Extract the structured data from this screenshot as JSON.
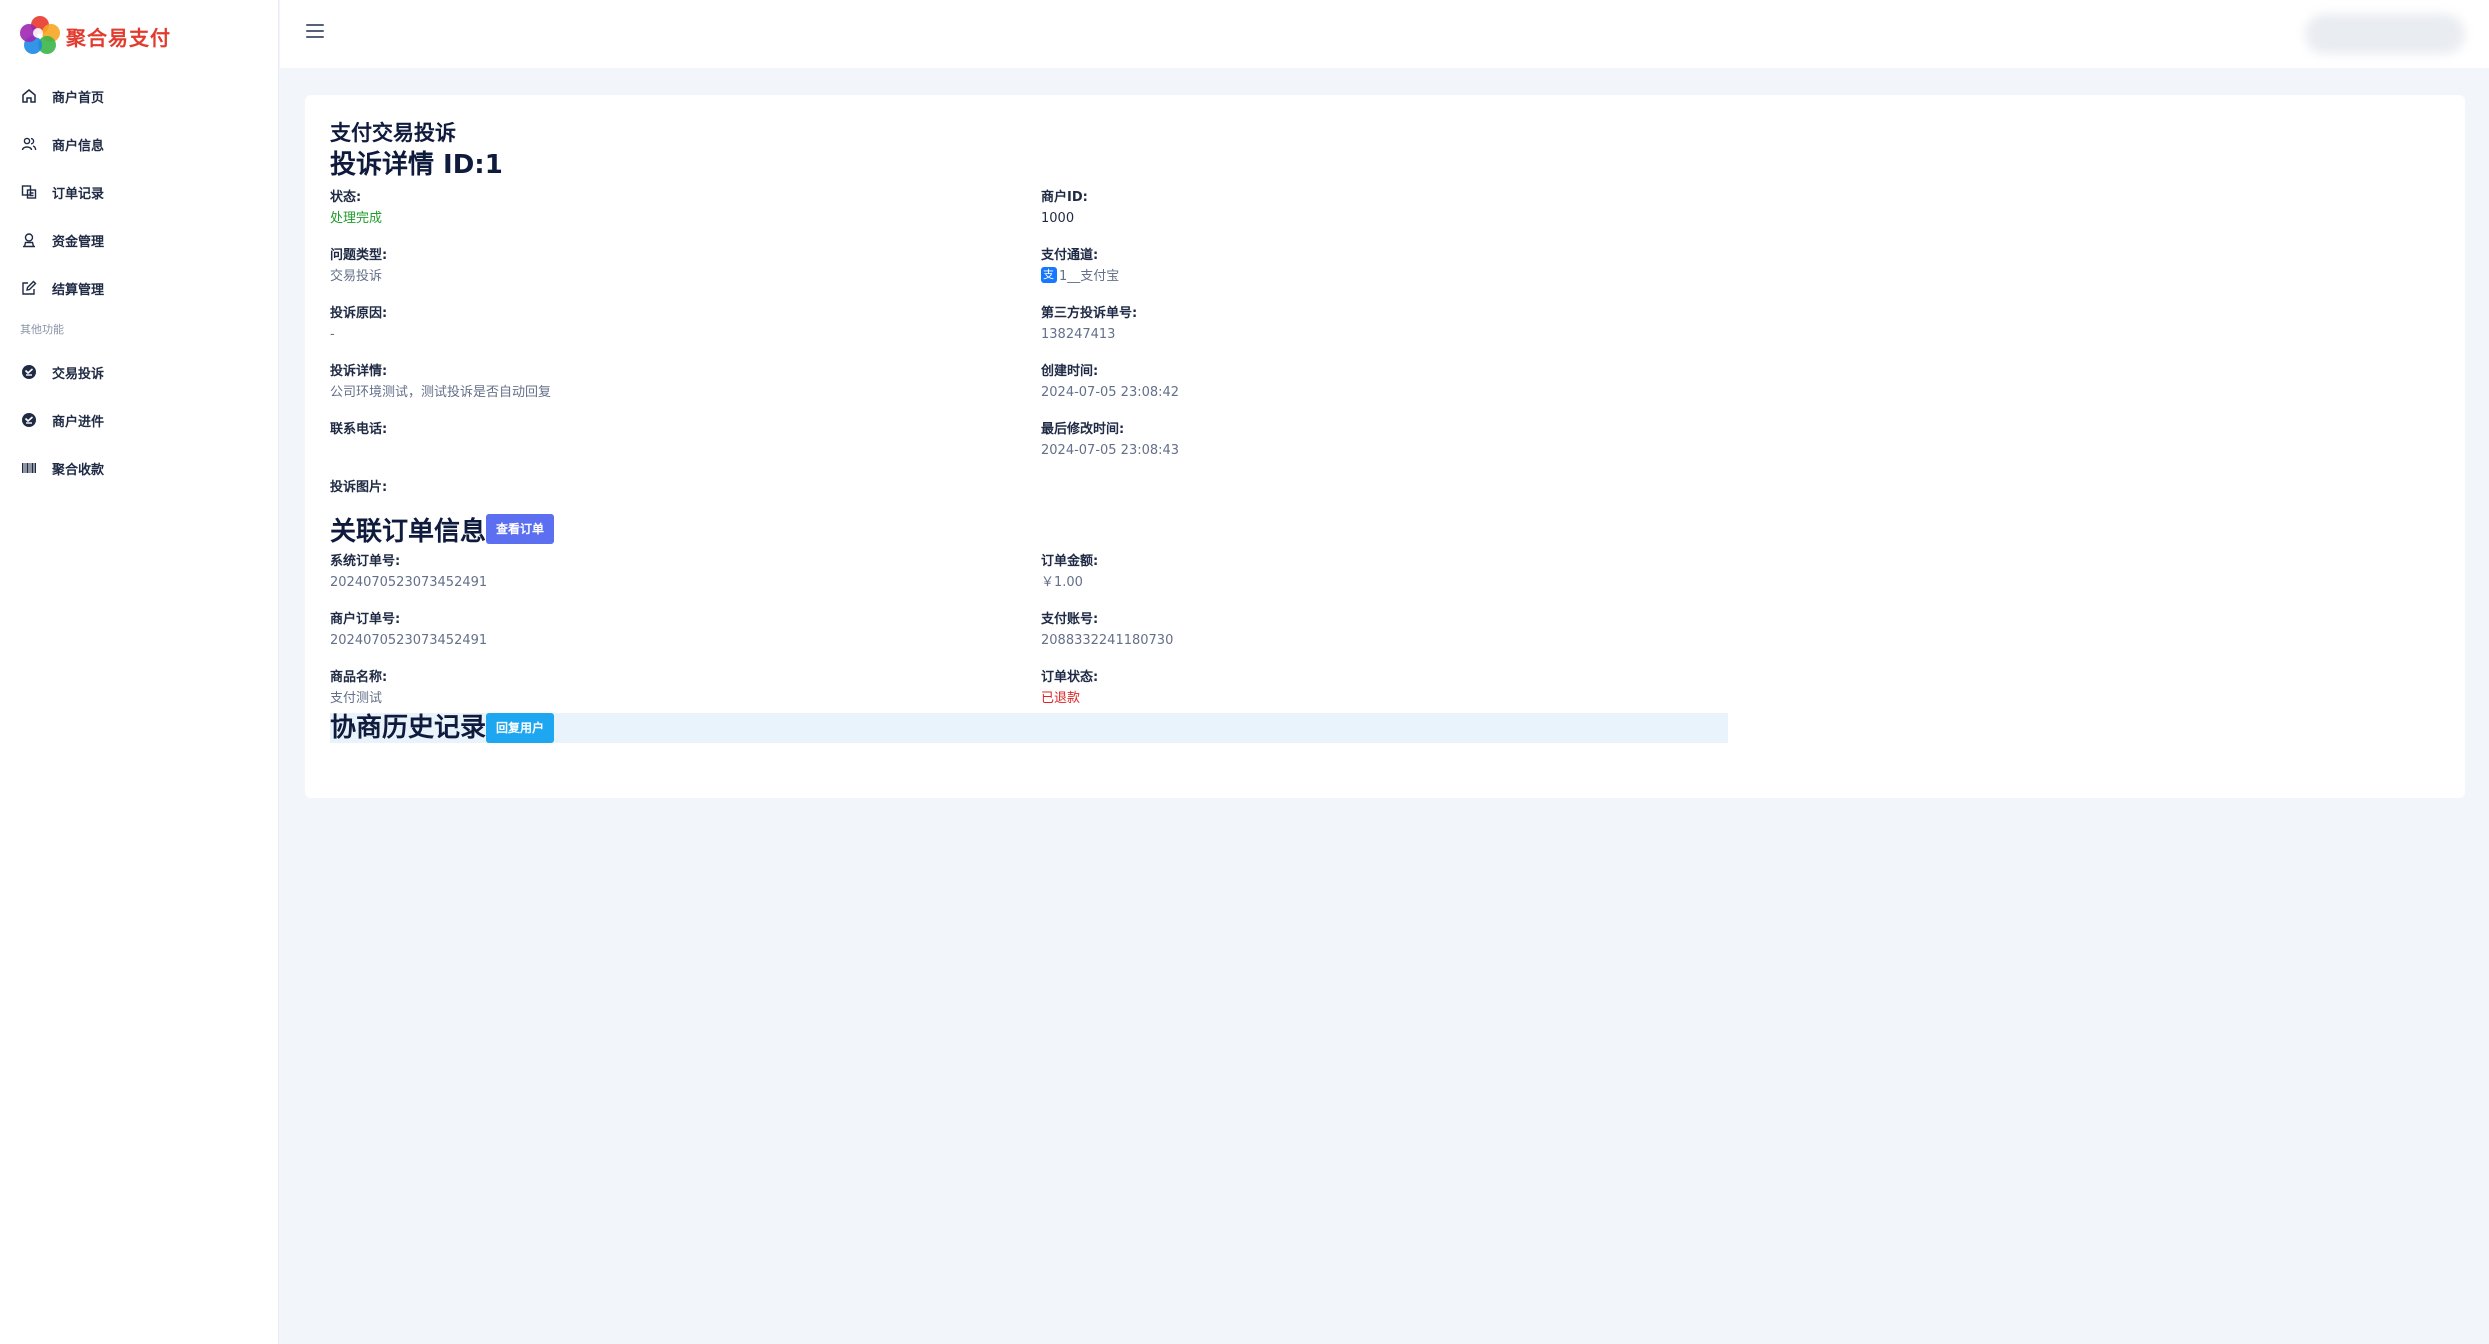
{
  "brand": {
    "name": "聚合易支付"
  },
  "sidebar": {
    "items": [
      {
        "label": "商户首页",
        "icon": "home-icon"
      },
      {
        "label": "商户信息",
        "icon": "users-icon"
      },
      {
        "label": "订单记录",
        "icon": "orders-icon"
      },
      {
        "label": "资金管理",
        "icon": "funds-icon"
      },
      {
        "label": "结算管理",
        "icon": "edit-icon"
      }
    ],
    "section_label": "其他功能",
    "other_items": [
      {
        "label": "交易投诉",
        "icon": "complaint-icon"
      },
      {
        "label": "商户进件",
        "icon": "onboarding-icon"
      },
      {
        "label": "聚合收款",
        "icon": "barcode-icon"
      }
    ]
  },
  "page": {
    "title": "支付交易投诉",
    "detail_title": "投诉详情 ID:1"
  },
  "complaint": {
    "status_label": "状态:",
    "status_value": "处理完成",
    "merchant_id_label": "商户ID:",
    "merchant_id_value": "1000",
    "type_label": "问题类型:",
    "type_value": "交易投诉",
    "channel_label": "支付通道:",
    "channel_value": "1__支付宝",
    "reason_label": "投诉原因:",
    "reason_value": "-",
    "third_no_label": "第三方投诉单号:",
    "third_no_value": "138247413",
    "detail_label": "投诉详情:",
    "detail_value": "公司环境测试，测试投诉是否自动回复",
    "created_label": "创建时间:",
    "created_value": "2024-07-05 23:08:42",
    "phone_label": "联系电话:",
    "phone_value": "",
    "modified_label": "最后修改时间:",
    "modified_value": "2024-07-05 23:08:43",
    "images_label": "投诉图片:"
  },
  "order": {
    "section_title": "关联订单信息",
    "view_button": "查看订单",
    "sys_no_label": "系统订单号:",
    "sys_no_value": "2024070523073452491",
    "amount_label": "订单金额:",
    "amount_value": "￥1.00",
    "mch_no_label": "商户订单号:",
    "mch_no_value": "2024070523073452491",
    "account_label": "支付账号:",
    "account_value": "2088332241180730",
    "goods_label": "商品名称:",
    "goods_value": "支付测试",
    "status_label": "订单状态:",
    "status_value": "已退款"
  },
  "history": {
    "section_title": "协商历史记录",
    "reply_button": "回复用户"
  },
  "colors": {
    "accent": "#5b6ff0",
    "info": "#1ea7f0",
    "success": "#1f9d2a",
    "danger": "#e02424"
  }
}
